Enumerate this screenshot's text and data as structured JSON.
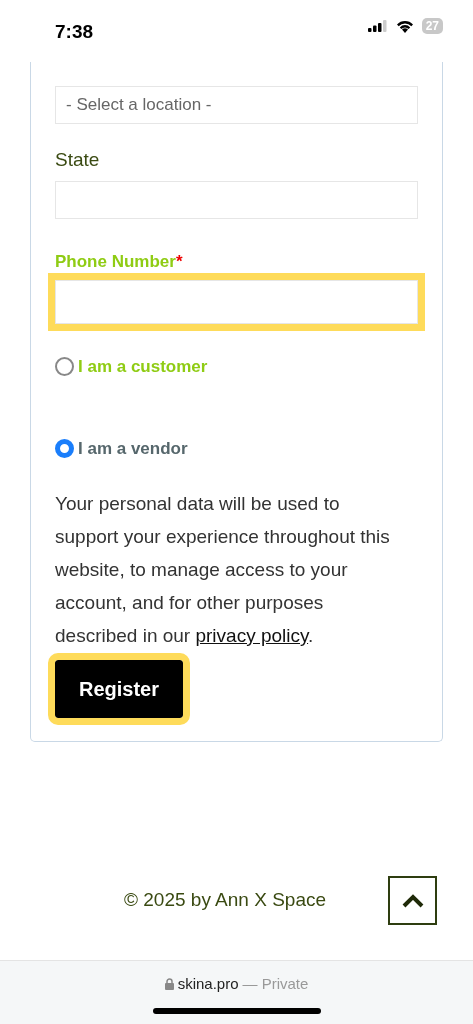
{
  "status_bar": {
    "time": "7:38",
    "battery": "27"
  },
  "form": {
    "location_select": {
      "value": "- Select a location -"
    },
    "fields": [
      {
        "label": "State",
        "required": false,
        "highlighted": false
      },
      {
        "label": "Phone Number",
        "required": true,
        "required_mark": "*",
        "highlighted": true
      }
    ],
    "roles": [
      {
        "label": "I am a customer",
        "selected": false
      },
      {
        "label": "I am a vendor",
        "selected": true
      }
    ],
    "privacy_text": "Your personal data will be used to support your experience throughout this website, to manage access to your account, and for other purposes described in our ",
    "privacy_link": "privacy policy",
    "privacy_end": ".",
    "register_button": {
      "label": "Register",
      "highlighted": true
    }
  },
  "footer": {
    "copyright": "© 2025 by Ann X Space"
  },
  "browser_bar": {
    "domain": "skina.pro",
    "mode": "— Private"
  }
}
